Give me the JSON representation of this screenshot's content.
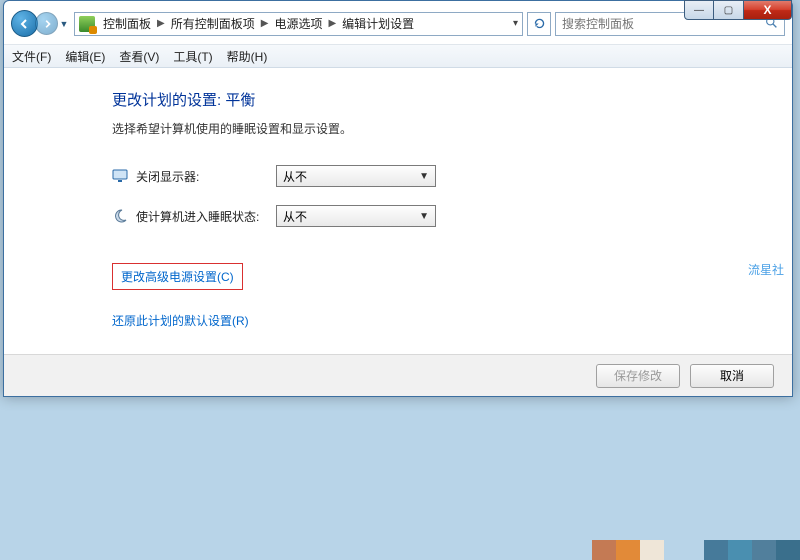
{
  "syscontrols": {
    "min": "—",
    "max": "▢",
    "close": "X"
  },
  "breadcrumb": {
    "items": [
      "控制面板",
      "所有控制面板项",
      "电源选项",
      "编辑计划设置"
    ]
  },
  "search": {
    "placeholder": "搜索控制面板"
  },
  "menubar": [
    "文件(F)",
    "编辑(E)",
    "查看(V)",
    "工具(T)",
    "帮助(H)"
  ],
  "page": {
    "heading": "更改计划的设置: 平衡",
    "desc": "选择希望计算机使用的睡眠设置和显示设置。",
    "display_off_label": "关闭显示器:",
    "sleep_label": "使计算机进入睡眠状态:",
    "never": "从不",
    "advanced_link": "更改高级电源设置(C)",
    "restore_link": "还原此计划的默认设置(R)"
  },
  "buttons": {
    "save": "保存修改",
    "cancel": "取消"
  },
  "watermark": "流星社",
  "swatch_colors": [
    "#c47a54",
    "#e28a38",
    "#efe6d8",
    "#467a9a",
    "#4a8fb0",
    "#517f9c",
    "#3a6f8c"
  ]
}
